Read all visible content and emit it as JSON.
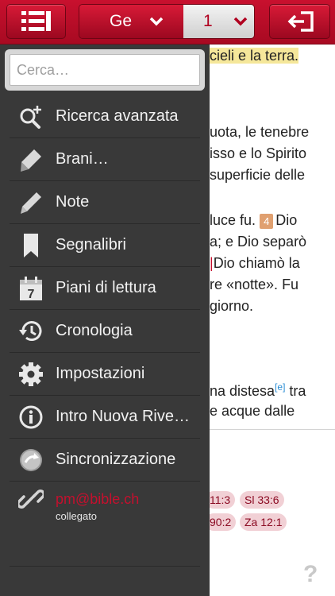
{
  "header": {
    "book": "Ge",
    "chapter": "1"
  },
  "page_text": {
    "line1": "cieli e la terra.",
    "line2": "uota, le tenebre",
    "line3a": "isso e lo Spirito",
    "line3b": "superficie delle",
    "line4_pre": "luce fu.",
    "line4_verse": "4",
    "line4_post": "Dio",
    "line5": "a; e Dio separò",
    "line6": "Dio chiamò la",
    "line7": "re «notte». Fu",
    "line8": "giorno.",
    "line9_pre": "na distesa",
    "line9_note": "[e]",
    "line9_post": "tra",
    "line10": "e acque dalle",
    "refs": [
      "11:3",
      "Sl 33:6",
      "90:2",
      "Za 12:1"
    ],
    "help_mark": "?"
  },
  "sidemenu": {
    "search_placeholder": "Cerca…",
    "items": [
      {
        "label": "Ricerca avanzata",
        "icon": "advanced-search-icon"
      },
      {
        "label": "Brani…",
        "icon": "highlighter-icon"
      },
      {
        "label": "Note",
        "icon": "pencil-icon"
      },
      {
        "label": "Segnalibri",
        "icon": "bookmark-icon"
      },
      {
        "label": "Piani di lettura",
        "icon": "calendar-icon"
      },
      {
        "label": "Cronologia",
        "icon": "history-icon"
      },
      {
        "label": "Impostazioni",
        "icon": "gear-icon"
      },
      {
        "label": "Intro Nuova Rive…",
        "icon": "info-icon"
      },
      {
        "label": "Sincronizzazione",
        "icon": "sync-icon"
      }
    ],
    "account": {
      "email": "pm@bible.ch",
      "status": "collegato",
      "icon": "link-icon"
    }
  },
  "colors": {
    "brand_red": "#c8102e",
    "menu_bg": "#393939",
    "highlight": "#f5e79a"
  }
}
